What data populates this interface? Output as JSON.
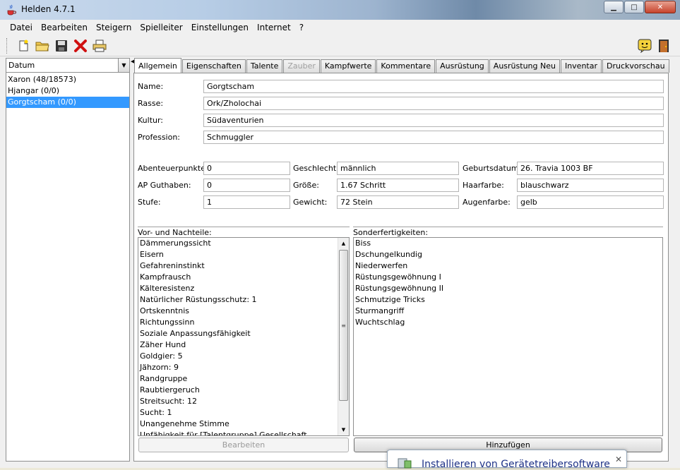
{
  "window": {
    "title": "Helden 4.7.1"
  },
  "menu": [
    "Datei",
    "Bearbeiten",
    "Steigern",
    "Spielleiter",
    "Einstellungen",
    "Internet",
    "?"
  ],
  "sidebar": {
    "sort_value": "Datum",
    "heroes": [
      "Xaron (48/18573)",
      "Hjangar (0/0)",
      "Gorgtscham (0/0)"
    ]
  },
  "tabs": [
    "Allgemein",
    "Eigenschaften",
    "Talente",
    "Zauber",
    "Kampfwerte",
    "Kommentare",
    "Ausrüstung",
    "Ausrüstung Neu",
    "Inventar",
    "Druckvorschau"
  ],
  "general": {
    "name_label": "Name:",
    "name_value": "Gorgtscham",
    "rasse_label": "Rasse:",
    "rasse_value": "Ork/Zholochai",
    "kultur_label": "Kultur:",
    "kultur_value": "Südaventurien",
    "profession_label": "Profession:",
    "profession_value": "Schmuggler",
    "ap_label": "Abenteuerpunkte:",
    "ap_value": "0",
    "apg_label": "AP Guthaben:",
    "apg_value": "0",
    "stufe_label": "Stufe:",
    "stufe_value": "1",
    "geschlecht_label": "Geschlecht:",
    "geschlecht_value": "männlich",
    "groesse_label": "Größe:",
    "groesse_value": "1.67 Schritt",
    "gewicht_label": "Gewicht:",
    "gewicht_value": "72 Stein",
    "geburt_label": "Geburtsdatum:",
    "geburt_value": "26. Travia 1003 BF",
    "haar_label": "Haarfarbe:",
    "haar_value": "blauschwarz",
    "augen_label": "Augenfarbe:",
    "augen_value": "gelb"
  },
  "vorteile": {
    "title": "Vor- und Nachteile:",
    "items": [
      "Dämmerungssicht",
      "Eisern",
      "Gefahreninstinkt",
      "Kampfrausch",
      "Kälteresistenz",
      "Natürlicher Rüstungsschutz: 1",
      "Ortskenntnis",
      "Richtungssinn",
      "Soziale Anpassungsfähigkeit",
      "Zäher Hund",
      "Goldgier: 5",
      "Jähzorn: 9",
      "Randgruppe",
      "Raubtiergeruch",
      "Streitsucht: 12",
      "Sucht: 1",
      "Unangenehme Stimme",
      "Unfähigkeit für [Talentgruppe] Gesellschaft"
    ],
    "button": "Bearbeiten"
  },
  "sonderfertigkeiten": {
    "title": "Sonderfertigkeiten:",
    "items": [
      "Biss",
      "Dschungelkundig",
      "Niederwerfen",
      "Rüstungsgewöhnung I",
      "Rüstungsgewöhnung II",
      "Schmutzige Tricks",
      "Sturmangriff",
      "Wuchtschlag"
    ],
    "button": "Hinzufügen"
  },
  "popup": {
    "text": "Installieren von Gerätetreibersoftware"
  }
}
